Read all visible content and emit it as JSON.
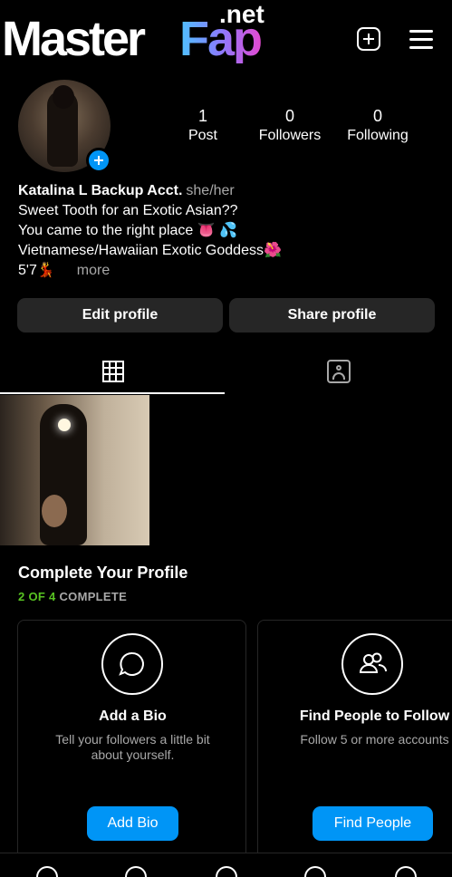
{
  "logo": {
    "word1": "Master",
    "word2": "Fap",
    "tld": ".net"
  },
  "header": {
    "new_post_icon": "plus-square-icon",
    "menu_icon": "hamburger-menu-icon"
  },
  "profile": {
    "posts": {
      "count": "1",
      "label": "Post"
    },
    "followers": {
      "count": "0",
      "label": "Followers"
    },
    "following": {
      "count": "0",
      "label": "Following"
    },
    "name": "Katalina L Backup Acct.",
    "pronouns": "she/her",
    "bio_line1": "Sweet Tooth for an Exotic Asian??",
    "bio_line2": "You came to the right place 👅 💦",
    "bio_line3": "Vietnamese/Hawaiian Exotic Goddess🌺",
    "bio_line4": "5'7💃",
    "more": "more"
  },
  "buttons": {
    "edit_profile": "Edit profile",
    "share_profile": "Share profile"
  },
  "tabs": {
    "grid_icon": "grid-icon",
    "tagged_icon": "tagged-icon"
  },
  "complete_profile": {
    "title": "Complete Your Profile",
    "progress_done": "2 OF 4",
    "progress_label": "COMPLETE",
    "progress_fraction": 0.5,
    "cards": [
      {
        "icon": "speech-bubble-icon",
        "title": "Add a Bio",
        "desc1": "Tell your followers a little bit",
        "desc2": "about yourself.",
        "button": "Add Bio"
      },
      {
        "icon": "people-icon",
        "title": "Find People to Follow",
        "desc1": "Follow 5 or more accounts",
        "desc2": "",
        "button": "Find People"
      }
    ]
  },
  "colors": {
    "accent": "#0095f6",
    "progress": "#58c322",
    "button_bg": "#262626",
    "muted": "#a8a8a8"
  }
}
